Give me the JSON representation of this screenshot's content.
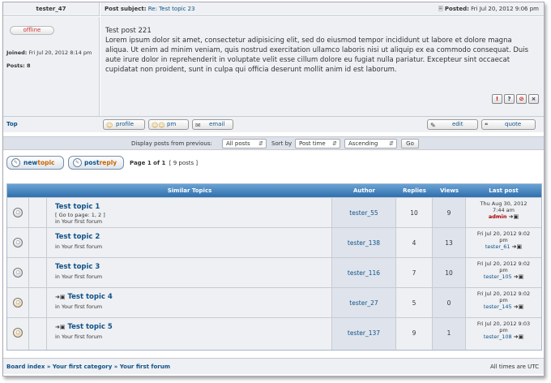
{
  "post": {
    "author": "tester_47",
    "subject_label": "Post subject:",
    "subject_link": "Re: Test topic 23",
    "posted_label": "Posted:",
    "posted_date": "Fri Jul 20, 2012 9:06 pm",
    "status": "offline",
    "joined_label": "Joined:",
    "joined_value": "Fri Jul 20, 2012 8:14 pm",
    "posts_label": "Posts:",
    "posts_value": "8",
    "title": "Test post 221",
    "body": "Lorem ipsum dolor sit amet, consectetur adipisicing elit, sed do eiusmod tempor incididunt ut labore et dolore magna aliqua. Ut enim ad minim veniam, quis nostrud exercitation ullamco laboris nisi ut aliquip ex ea commodo consequat. Duis aute irure dolor in reprehenderit in voluptate velit esse cillum dolore eu fugiat nulla pariatur. Excepteur sint occaecat cupidatat non proident, sunt in culpa qui officia deserunt mollit anim id est laborum.",
    "report_icons": [
      "!",
      "?",
      "⊘",
      "×"
    ],
    "top_link": "Top",
    "buttons": {
      "profile": "profile",
      "pm": "pm",
      "email": "email",
      "edit": "edit",
      "quote": "quote"
    }
  },
  "filter": {
    "display_label": "Display posts from previous:",
    "days_value": "All posts",
    "sort_label": "Sort by",
    "sort_value": "Post time",
    "order_value": "Ascending",
    "go": "Go"
  },
  "actions": {
    "newtopic_a": "new",
    "newtopic_b": "topic",
    "postreply_a": "post",
    "postreply_b": "reply",
    "page_label": "Page 1 of 1",
    "count_label": "[ 9 posts ]"
  },
  "similar": {
    "headers": {
      "title": "Similar Topics",
      "author": "Author",
      "replies": "Replies",
      "views": "Views",
      "last_post": "Last post"
    },
    "topics": [
      {
        "title": "Test topic 1",
        "goto": "[ Go to page: 1, 2 ]",
        "forum": "in Your first forum",
        "author": "tester_55",
        "replies": "10",
        "views": "9",
        "last_date": "Thu Aug 30, 2012",
        "last_time": "7:44 am",
        "last_by": "admin",
        "moved": false
      },
      {
        "title": "Test topic 2",
        "goto": "",
        "forum": "in Your first forum",
        "author": "tester_138",
        "replies": "4",
        "views": "13",
        "last_date": "Fri Jul 20, 2012 9:02",
        "last_time": "pm",
        "last_by": "tester_61",
        "moved": false
      },
      {
        "title": "Test topic 3",
        "goto": "",
        "forum": "in Your first forum",
        "author": "tester_116",
        "replies": "7",
        "views": "10",
        "last_date": "Fri Jul 20, 2012 9:02",
        "last_time": "pm",
        "last_by": "tester_105",
        "moved": false
      },
      {
        "title": "Test topic 4",
        "goto": "",
        "forum": "in Your first forum",
        "author": "tester_27",
        "replies": "5",
        "views": "0",
        "last_date": "Fri Jul 20, 2012 9:02",
        "last_time": "pm",
        "last_by": "tester_145",
        "moved": true
      },
      {
        "title": "Test topic 5",
        "goto": "",
        "forum": "in Your first forum",
        "author": "tester_137",
        "replies": "9",
        "views": "1",
        "last_date": "Fri Jul 20, 2012 9:03",
        "last_time": "pm",
        "last_by": "tester_108",
        "moved": true
      }
    ]
  },
  "footer": {
    "crumbs": "Board index » Your first category » Your first forum",
    "timezone": "All times are UTC"
  },
  "colors": {
    "link": "#105289",
    "admin": "#aa0000",
    "offline": "#d03030",
    "header_blue": "#2f6fae"
  }
}
